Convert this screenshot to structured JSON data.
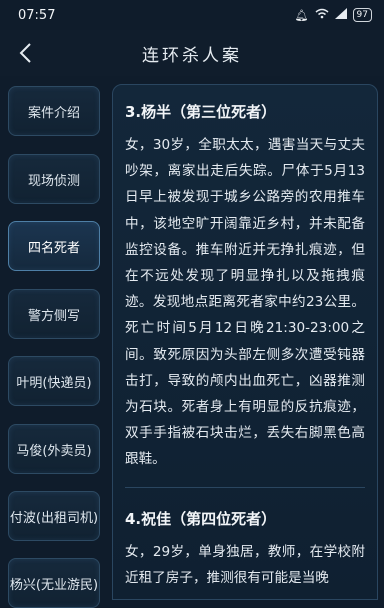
{
  "status_bar": {
    "time": "07:57",
    "battery": "97"
  },
  "header": {
    "title": "连环杀人案"
  },
  "sidebar": {
    "items": [
      {
        "label": "案件介绍",
        "active": false
      },
      {
        "label": "现场侦测",
        "active": false
      },
      {
        "label": "四名死者",
        "active": true
      },
      {
        "label": "警方侧写",
        "active": false
      },
      {
        "label": "叶明(快递员)",
        "active": false
      },
      {
        "label": "马俊(外卖员)",
        "active": false
      },
      {
        "label": "付波(出租司机)",
        "active": false
      },
      {
        "label": "杨兴(无业游民)",
        "active": false
      }
    ]
  },
  "content": {
    "sections": [
      {
        "title": "3.杨半（第三位死者）",
        "body": "女，30岁，全职太太，遇害当天与丈夫吵架，离家出走后失踪。尸体于5月13日早上被发现于城乡公路旁的农用推车中，该地空旷开阔靠近乡村，并未配备监控设备。推车附近并无挣扎痕迹，但在不远处发现了明显挣扎以及拖拽痕迹。发现地点距离死者家中约23公里。死亡时间5月12日晚21:30-23:00之间。致死原因为头部左侧多次遭受钝器击打，导致的颅内出血死亡，凶器推测为石块。死者身上有明显的反抗痕迹，双手手指被石块击烂，丢失右脚黑色高跟鞋。"
      },
      {
        "title": "4.祝佳（第四位死者）",
        "body": "女，29岁，单身独居，教师，在学校附近租了房子，推测很有可能是当晚"
      }
    ]
  }
}
